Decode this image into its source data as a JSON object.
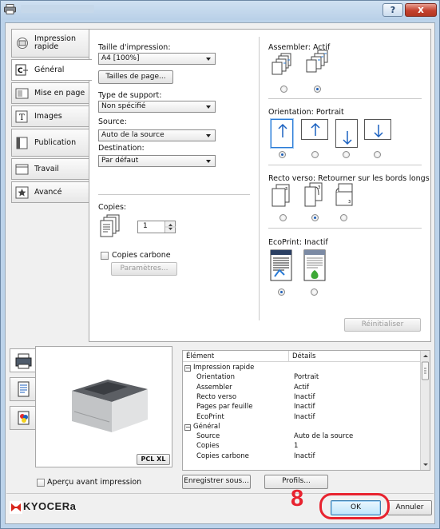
{
  "window": {
    "title_blurred": ""
  },
  "titlebar": {
    "help": "?",
    "close": "x"
  },
  "tabs": [
    {
      "label": "Impression\nrapide",
      "icon": "quick-print-icon"
    },
    {
      "label": "Général",
      "icon": "general-icon"
    },
    {
      "label": "Mise en page",
      "icon": "layout-icon"
    },
    {
      "label": "Images",
      "icon": "images-icon"
    },
    {
      "label": "Publication",
      "icon": "publishing-icon"
    },
    {
      "label": "Travail",
      "icon": "job-icon"
    },
    {
      "label": "Avancé",
      "icon": "advanced-icon"
    }
  ],
  "general": {
    "print_size_label": "Taille d'impression:",
    "print_size_value": "A4  [100%]",
    "page_sizes_button": "Tailles de page...",
    "media_type_label": "Type de support:",
    "media_type_value": "Non spécifié",
    "source_label": "Source:",
    "source_value": "Auto de la source",
    "destination_label": "Destination:",
    "destination_value": "Par défaut",
    "copies_label": "Copies:",
    "copies_value": "1",
    "carbon_copies_label": "Copies carbone",
    "settings_button": "Paramètres..."
  },
  "right": {
    "collate_label": "Assembler: Actif",
    "orientation_label": "Orientation: Portrait",
    "duplex_label": "Recto verso: Retourner sur les bords longs",
    "ecoprint_label": "EcoPrint: Inactif",
    "reset_button": "Réinitialiser"
  },
  "grid": {
    "col_item": "Élément",
    "col_details": "Détails",
    "rows": [
      {
        "item": "Impression rapide",
        "detail": "",
        "group": true
      },
      {
        "item": "Orientation",
        "detail": "Portrait",
        "group": false
      },
      {
        "item": "Assembler",
        "detail": "Actif",
        "group": false
      },
      {
        "item": "Recto verso",
        "detail": "Inactif",
        "group": false
      },
      {
        "item": "Pages par feuille",
        "detail": "Inactif",
        "group": false
      },
      {
        "item": "EcoPrint",
        "detail": "Inactif",
        "group": false
      },
      {
        "item": "Général",
        "detail": "",
        "group": true
      },
      {
        "item": "Source",
        "detail": "Auto de la source",
        "group": false
      },
      {
        "item": "Copies",
        "detail": "1",
        "group": false
      },
      {
        "item": "Copies carbone",
        "detail": "Inactif",
        "group": false
      }
    ]
  },
  "preview": {
    "pdl_badge": "PCL XL"
  },
  "footer": {
    "print_preview_label": "Aperçu avant impression",
    "save_as_button": "Enregistrer sous...",
    "profiles_button": "Profils...",
    "brand": "KYOCERa",
    "ok_button": "OK",
    "cancel_button": "Annuler",
    "step_number": "8"
  },
  "colors": {
    "accent_red": "#e8232f",
    "brand_red": "#d9261c",
    "selection_blue": "#2a7bd6"
  }
}
